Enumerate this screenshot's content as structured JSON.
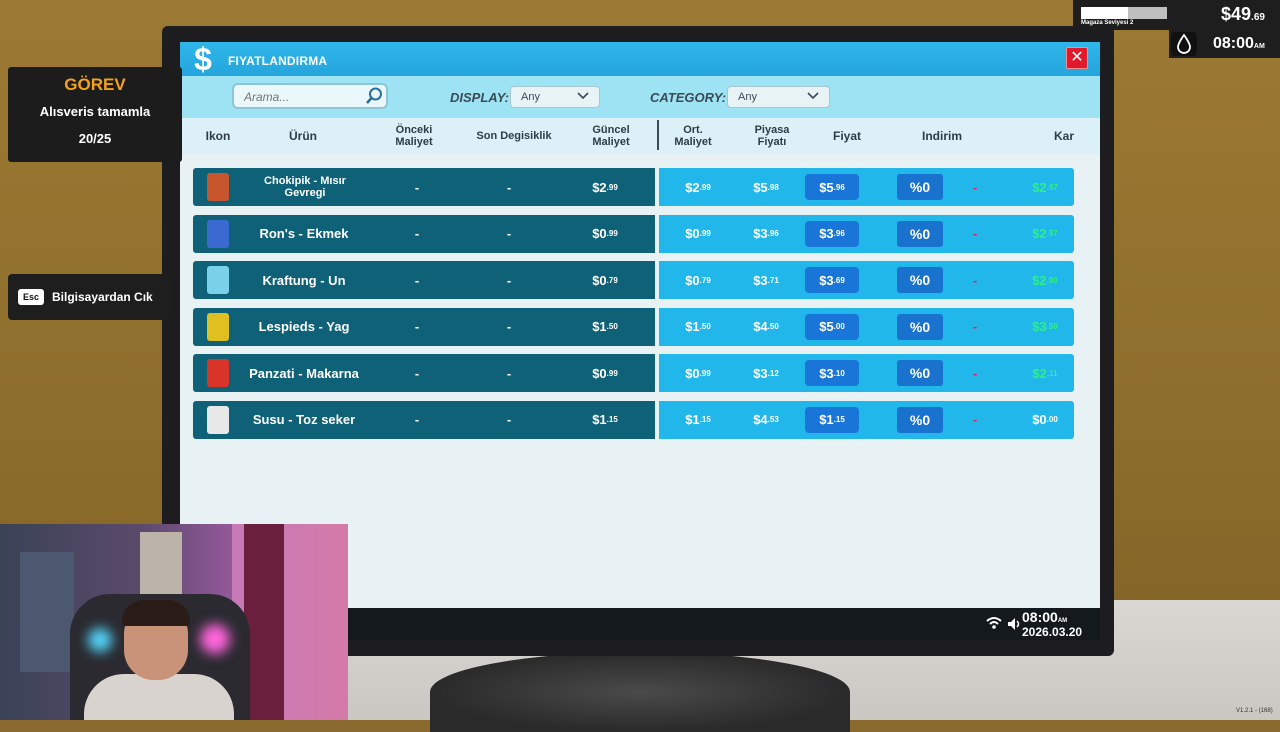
{
  "window": {
    "title": "FIYATLANDIRMA",
    "close_label": "✕"
  },
  "filters": {
    "search_placeholder": "Arama...",
    "display_label": "DISPLAY:",
    "display_value": "Any",
    "category_label": "CATEGORY:",
    "category_value": "Any"
  },
  "columns": {
    "ikon": "Ikon",
    "urun": "Ürün",
    "onceki_1": "Önceki",
    "onceki_2": "Maliyet",
    "son": "Son Degisiklik",
    "guncel_1": "Güncel",
    "guncel_2": "Maliyet",
    "ort_1": "Ort.",
    "ort_2": "Maliyet",
    "piyasa_1": "Piyasa",
    "piyasa_2": "Fiyatı",
    "fiyat": "Fiyat",
    "indirim": "Indirim",
    "kar": "Kar"
  },
  "rows": [
    {
      "name1": "Chokipik - Mısır",
      "name2": "Gevregi",
      "prev": "-",
      "last": "-",
      "cur": "$2",
      "cur_c": ".99",
      "avg": "$2",
      "avg_c": ".99",
      "market": "$5",
      "market_c": ".98",
      "price": "$5",
      "price_c": ".96",
      "disc": "%0",
      "disc_amt": "-",
      "profit": "$2",
      "profit_c": ".97",
      "icon_color": "#c7562f"
    },
    {
      "name1": "Ron's - Ekmek",
      "name2": "",
      "prev": "-",
      "last": "-",
      "cur": "$0",
      "cur_c": ".99",
      "avg": "$0",
      "avg_c": ".99",
      "market": "$3",
      "market_c": ".96",
      "price": "$3",
      "price_c": ".96",
      "disc": "%0",
      "disc_amt": "-",
      "profit": "$2",
      "profit_c": ".97",
      "icon_color": "#3a6ad0"
    },
    {
      "name1": "Kraftung - Un",
      "name2": "",
      "prev": "-",
      "last": "-",
      "cur": "$0",
      "cur_c": ".79",
      "avg": "$0",
      "avg_c": ".79",
      "market": "$3",
      "market_c": ".71",
      "price": "$3",
      "price_c": ".69",
      "disc": "%0",
      "disc_amt": "-",
      "profit": "$2",
      "profit_c": ".90",
      "icon_color": "#7ad0e8"
    },
    {
      "name1": "Lespieds - Yag",
      "name2": "",
      "prev": "-",
      "last": "-",
      "cur": "$1",
      "cur_c": ".50",
      "avg": "$1",
      "avg_c": ".50",
      "market": "$4",
      "market_c": ".50",
      "price": "$5",
      "price_c": ".00",
      "disc": "%0",
      "disc_amt": "-",
      "profit": "$3",
      "profit_c": ".50",
      "icon_color": "#e0c020"
    },
    {
      "name1": "Panzati - Makarna",
      "name2": "",
      "prev": "-",
      "last": "-",
      "cur": "$0",
      "cur_c": ".99",
      "avg": "$0",
      "avg_c": ".99",
      "market": "$3",
      "market_c": ".12",
      "price": "$3",
      "price_c": ".10",
      "disc": "%0",
      "disc_amt": "-",
      "profit": "$2",
      "profit_c": ".11",
      "icon_color": "#d8342a"
    },
    {
      "name1": "Susu - Toz seker",
      "name2": "",
      "prev": "-",
      "last": "-",
      "cur": "$1",
      "cur_c": ".15",
      "avg": "$1",
      "avg_c": ".15",
      "market": "$4",
      "market_c": ".53",
      "price": "$1",
      "price_c": ".15",
      "disc": "%0",
      "disc_amt": "-",
      "profit": "$0",
      "profit_c": ".00",
      "icon_color": "#e8e8e8"
    }
  ],
  "taskbar": {
    "time": "08:00",
    "time_suffix": "AM",
    "date": "2026.03.20"
  },
  "hud": {
    "quest_title": "GÖREV",
    "quest_task": "Alısveris tamamla",
    "quest_progress": "20/25",
    "esc_key": "Esc",
    "exit_label": "Bilgisayardan Cık",
    "store_level": "Magaza Seviyesi 2",
    "store_level_fraction": 0.55,
    "money": "$49",
    "money_cents": ".69",
    "clock": "08:00",
    "clock_suffix": "AM",
    "version": "V1.2.1 - (168)"
  }
}
